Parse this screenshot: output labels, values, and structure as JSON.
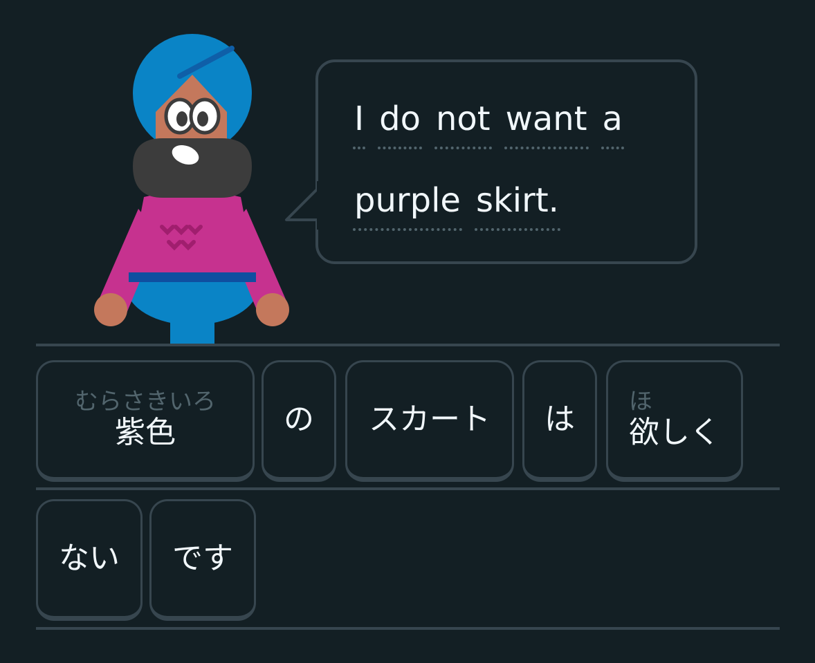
{
  "colors": {
    "background": "#131f24",
    "border": "#37464f",
    "text": "#f1f7fb",
    "furigana": "#52656d",
    "turban": "#0a84c6",
    "sweater": "#c6328f",
    "beard": "#3c3c3c",
    "skin": "#c4785c"
  },
  "character": {
    "icon": "character-avatar"
  },
  "prompt": {
    "line1": [
      "I",
      "do",
      "not",
      "want",
      "a"
    ],
    "line2": [
      "purple",
      "skirt."
    ]
  },
  "word_bank": {
    "row1": [
      {
        "furigana": "むらさきいろ",
        "text": "紫色"
      },
      {
        "furigana": "",
        "text": "の"
      },
      {
        "furigana": "",
        "text": "スカート"
      },
      {
        "furigana": "",
        "text": "は"
      },
      {
        "furigana": "ほ",
        "text": "欲しく"
      }
    ],
    "row2": [
      {
        "furigana": "",
        "text": "ない"
      },
      {
        "furigana": "",
        "text": "です"
      }
    ]
  }
}
